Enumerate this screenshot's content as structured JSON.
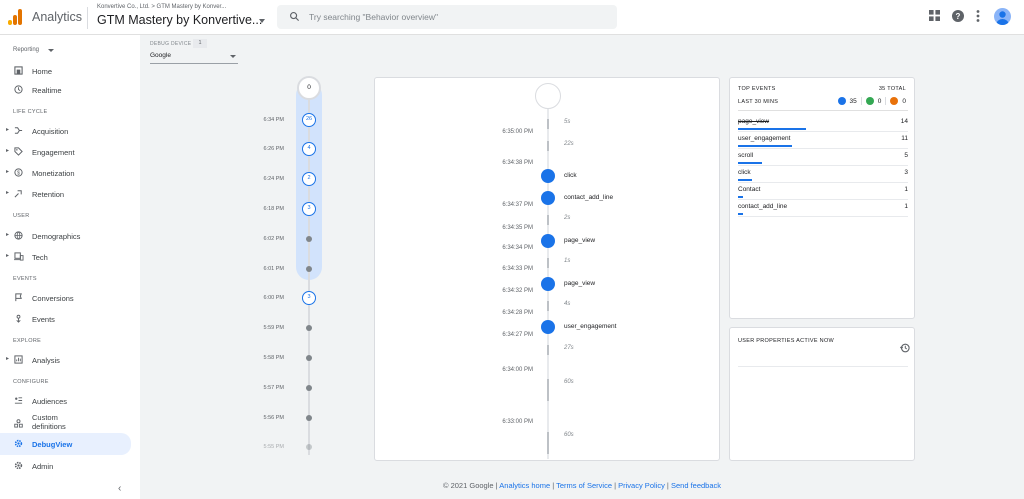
{
  "header": {
    "app_name": "Analytics",
    "breadcrumb": "Konvertive Co., Ltd. > GTM Mastery by Konver...",
    "property_title": "GTM Mastery by Konvertive...",
    "search_placeholder": "Try searching \"Behavior overview\""
  },
  "sidebar": {
    "reporting_label": "Reporting",
    "items": {
      "home": "Home",
      "realtime": "Realtime",
      "acquisition": "Acquisition",
      "engagement": "Engagement",
      "monetization": "Monetization",
      "retention": "Retention",
      "demographics": "Demographics",
      "tech": "Tech",
      "conversions": "Conversions",
      "events": "Events",
      "analysis": "Analysis",
      "audiences": "Audiences",
      "custom_definitions": "Custom definitions",
      "debugview": "DebugView",
      "admin": "Admin"
    },
    "sections": {
      "life_cycle": "LIFE CYCLE",
      "user": "USER",
      "events": "EVENTS",
      "explore": "EXPLORE",
      "configure": "CONFIGURE"
    }
  },
  "debug_device": {
    "label": "DEBUG DEVICE",
    "count": "1",
    "selected": "Google"
  },
  "minutes_stream": {
    "top_count": "0",
    "rows": [
      {
        "time": "6:34 PM",
        "count": "26"
      },
      {
        "time": "6:26 PM",
        "count": "4"
      },
      {
        "time": "6:24 PM",
        "count": "2"
      },
      {
        "time": "6:18 PM",
        "count": "3"
      },
      {
        "time": "6:02 PM",
        "count": ""
      },
      {
        "time": "6:01 PM",
        "count": ""
      },
      {
        "time": "6:00 PM",
        "count": "3"
      },
      {
        "time": "5:59 PM",
        "count": ""
      },
      {
        "time": "5:58 PM",
        "count": ""
      },
      {
        "time": "5:57 PM",
        "count": ""
      },
      {
        "time": "5:56 PM",
        "count": ""
      },
      {
        "time": "5:55 PM",
        "count": ""
      }
    ]
  },
  "seconds_stream": {
    "entries": [
      {
        "kind": "gap",
        "text": "5s"
      },
      {
        "kind": "time",
        "text": "6:35:00 PM"
      },
      {
        "kind": "gap",
        "text": "22s"
      },
      {
        "kind": "time",
        "text": "6:34:38 PM"
      },
      {
        "kind": "event",
        "text": "click"
      },
      {
        "kind": "event",
        "text": "contact_add_line"
      },
      {
        "kind": "time",
        "text": "6:34:37 PM"
      },
      {
        "kind": "gap",
        "text": "2s"
      },
      {
        "kind": "time",
        "text": "6:34:35 PM"
      },
      {
        "kind": "event",
        "text": "page_view"
      },
      {
        "kind": "time",
        "text": "6:34:34 PM"
      },
      {
        "kind": "gap",
        "text": "1s"
      },
      {
        "kind": "time",
        "text": "6:34:33 PM"
      },
      {
        "kind": "event",
        "text": "page_view"
      },
      {
        "kind": "time",
        "text": "6:34:32 PM"
      },
      {
        "kind": "gap",
        "text": "4s"
      },
      {
        "kind": "time",
        "text": "6:34:28 PM"
      },
      {
        "kind": "event",
        "text": "user_engagement"
      },
      {
        "kind": "time",
        "text": "6:34:27 PM"
      },
      {
        "kind": "gap",
        "text": "27s"
      },
      {
        "kind": "time",
        "text": "6:34:00 PM"
      },
      {
        "kind": "gap",
        "text": "60s"
      },
      {
        "kind": "time",
        "text": "6:33:00 PM"
      },
      {
        "kind": "gap",
        "text": "60s"
      }
    ]
  },
  "top_events": {
    "title": "TOP EVENTS",
    "total_label": "35 TOTAL",
    "subtitle": "LAST 30 MINS",
    "count_blue": "35",
    "count_green": "0",
    "count_orange": "0",
    "rows": [
      {
        "name": "page_view",
        "count": "14",
        "fraction": 1.0
      },
      {
        "name": "user_engagement",
        "count": "11",
        "fraction": 0.79
      },
      {
        "name": "scroll",
        "count": "5",
        "fraction": 0.36
      },
      {
        "name": "click",
        "count": "3",
        "fraction": 0.21
      },
      {
        "name": "Contact",
        "count": "1",
        "fraction": 0.07
      },
      {
        "name": "contact_add_line",
        "count": "1",
        "fraction": 0.07
      }
    ]
  },
  "user_properties": {
    "title": "USER PROPERTIES ACTIVE NOW"
  },
  "footer": {
    "copyright": "© 2021 Google",
    "link_home": "Analytics home",
    "link_terms": "Terms of Service",
    "link_privacy": "Privacy Policy",
    "link_feedback": "Send feedback",
    "separator": "|"
  },
  "colors": {
    "accent": "#1a73e8",
    "highlight": "#d2e3fc",
    "green": "#34a853",
    "orange": "#e8710a"
  }
}
